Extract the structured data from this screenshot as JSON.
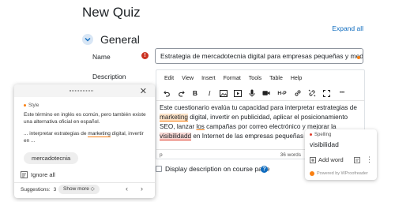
{
  "page": {
    "title": "New Quiz",
    "expand_all": "Expand all"
  },
  "section": {
    "title": "General",
    "toggle_icon": "chevron-down-icon"
  },
  "form": {
    "name_label": "Name",
    "required_icon": "exclamation-icon",
    "name_value": "Estrategia de mercadotecnia digital para empresas pequeñas y medianas",
    "description_label": "Description",
    "display_description_label": "Display description on course page",
    "help_icon": "question-icon"
  },
  "editor": {
    "menu": [
      "Edit",
      "View",
      "Insert",
      "Format",
      "Tools",
      "Table",
      "Help"
    ],
    "toolbar_icons": [
      "undo-icon",
      "redo-icon",
      "bold-icon",
      "italic-icon",
      "image-icon",
      "media-icon",
      "microphone-icon",
      "video-camera-icon",
      "h5p-icon",
      "link-icon",
      "unlink-icon",
      "fullscreen-icon",
      "more-icon"
    ],
    "toolbar_text": {
      "bold": "B",
      "italic": "I",
      "h5p": "H-P",
      "more": "•••"
    },
    "content": {
      "p1": "Este cuestionario evalúa tu capacidad para interpretar estrategias de ",
      "w1": "marketing",
      "p2": " digital, invertir en publicidad, aplicar el posicionamiento SEO, lanzar ",
      "w2": "los",
      "p3": " campañas por correo electrónico y mejorar la ",
      "w3": "visibilidadd",
      "p4": " en Internet de las empresas pequeñas y medianas."
    },
    "status_path": "p",
    "word_count": "36 words"
  },
  "spelling_popup": {
    "category": "Spelling",
    "suggestion": "visibilidad",
    "add_word": "Add word",
    "add_word_icon": "book-plus-icon",
    "ignore_icon": "ignore-icon",
    "more_icon": "kebab-icon",
    "powered_by": "Powered by WProofreader"
  },
  "style_popup": {
    "category": "Style",
    "message": "Este término en inglés es común, pero también existe una alternativa oficial en español.",
    "context_before": "... interpretar estrategias de ",
    "context_word": "marketing",
    "context_after": " digital, invertir en ...",
    "suggestion": "mercadotecnia",
    "ignore_all": "Ignore all",
    "suggestions_label": "Suggestions:",
    "suggestions_count": "3",
    "show_more": "Show more ◇"
  },
  "colors": {
    "accent": "#0f6cbf",
    "required": "#ca3120",
    "wproof_orange": "#f98012",
    "spelling_red": "#e03f2e"
  }
}
